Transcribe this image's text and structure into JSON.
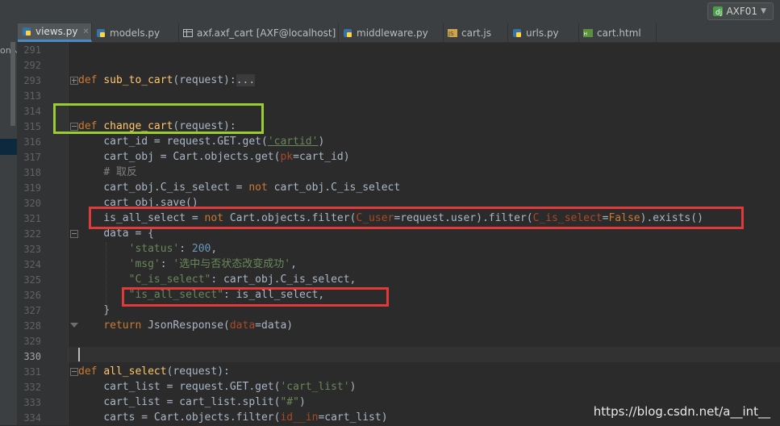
{
  "run_config": {
    "label": "AXF01",
    "color": "#4a9e4a"
  },
  "tabs": [
    {
      "label": "views.py",
      "icon": "python-file-icon",
      "active": true
    },
    {
      "label": "models.py",
      "icon": "python-file-icon",
      "active": false
    },
    {
      "label": "axf.axf_cart [AXF@localhost]",
      "icon": "table-icon",
      "active": false
    },
    {
      "label": "middleware.py",
      "icon": "python-file-icon",
      "active": false
    },
    {
      "label": "cart.js",
      "icon": "js-file-icon",
      "active": false
    },
    {
      "label": "urls.py",
      "icon": "python-file-icon",
      "active": false
    },
    {
      "label": "cart.html",
      "icon": "html-file-icon",
      "active": false
    }
  ],
  "side_label": "on↖",
  "line_numbers": [
    "291",
    "292",
    "293",
    "313",
    "314",
    "315",
    "316",
    "317",
    "318",
    "319",
    "320",
    "321",
    "322",
    "323",
    "324",
    "325",
    "326",
    "327",
    "328",
    "329",
    "330",
    "331",
    "332",
    "333",
    "334"
  ],
  "current_line": "330",
  "tokens": {
    "def": "def",
    "sub_to_cart": "sub_to_cart",
    "request_sig": "(request):",
    "ellipsis": "...",
    "change_cart": "change_cart",
    "cart_id_assign": "cart_id = request.GET.get(",
    "cartid": "'cartid'",
    "rparen": ")",
    "cart_obj_assign": "cart_obj = Cart.objects.get(",
    "pk": "pk",
    "eq_cart_id": "=cart_id)",
    "comment": "# 取反",
    "is_select_assign": "cart_obj.C_is_select = ",
    "not": "not",
    "is_select_rhs": " cart_obj.C_is_select",
    "save": "cart_obj.save()",
    "all_select_assign": "is_all_select = ",
    "filter1": " Cart.objects.filter(",
    "c_user": "C_user",
    "filter1_rest": "=request.user).filter(",
    "c_is_select": "C_is_select",
    "eq": "=",
    "false": "False",
    "exists": ").exists()",
    "data_open": "data = {",
    "status_key": "'status'",
    "colon": ": ",
    "status_val": "200",
    "comma": ",",
    "msg_key": "'msg'",
    "msg_val": "'选中与否状态改变成功'",
    "c_is_select_key": "\"C_is_select\"",
    "c_is_select_val": ": cart_obj.C_is_select,",
    "is_all_key": "\"is_all_select\"",
    "is_all_val": ": is_all_select,",
    "close_brace": "}",
    "return": "return",
    "json_resp": " JsonResponse(",
    "data_kw": "data",
    "eq_data": "=data)",
    "all_select": "all_select",
    "cart_list_assign": "cart_list = request.GET.get(",
    "cart_list_str": "'cart_list'",
    "split_line": "cart_list = cart_list.split(",
    "hash": "\"#\"",
    "carts_assign": "carts = Cart.objects.filter(",
    "id_in": "id__in",
    "eq_cart_list": "=cart_list)"
  },
  "watermark": "https://blog.csdn.net/a__int__"
}
